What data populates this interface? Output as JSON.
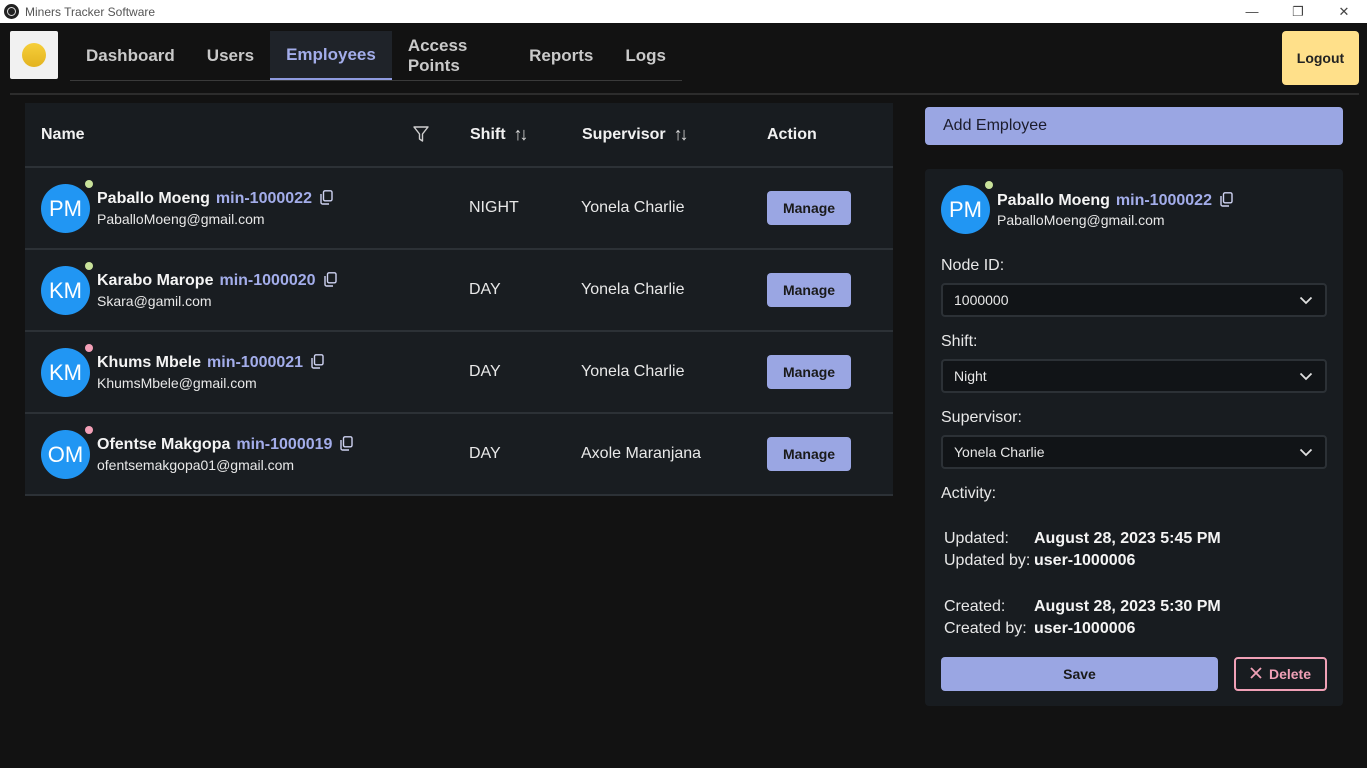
{
  "window": {
    "title": "Miners Tracker Software",
    "minimize": "—",
    "restore": "❐",
    "close": "✕"
  },
  "nav": {
    "items": [
      {
        "label": "Dashboard"
      },
      {
        "label": "Users"
      },
      {
        "label": "Employees",
        "active": true
      },
      {
        "label": "Access Points"
      },
      {
        "label": "Reports"
      },
      {
        "label": "Logs"
      }
    ],
    "logout_label": "Logout"
  },
  "table": {
    "headers": {
      "name": "Name",
      "shift": "Shift",
      "supervisor": "Supervisor",
      "action": "Action"
    },
    "rows": [
      {
        "initials": "PM",
        "name": "Paballo Moeng",
        "id": "min-1000022",
        "email": "PaballoMoeng@gmail.com",
        "shift": "NIGHT",
        "supervisor": "Yonela Charlie",
        "action": "Manage",
        "status_color": "#c9e29a"
      },
      {
        "initials": "KM",
        "name": "Karabo Marope",
        "id": "min-1000020",
        "email": "Skara@gamil.com",
        "shift": "DAY",
        "supervisor": "Yonela Charlie",
        "action": "Manage",
        "status_color": "#c9e29a"
      },
      {
        "initials": "KM",
        "name": "Khums Mbele",
        "id": "min-1000021",
        "email": "KhumsMbele@gmail.com",
        "shift": "DAY",
        "supervisor": "Yonela Charlie",
        "action": "Manage",
        "status_color": "#f3a0b7"
      },
      {
        "initials": "OM",
        "name": "Ofentse Makgopa",
        "id": "min-1000019",
        "email": "ofentsemakgopa01@gmail.com",
        "shift": "DAY",
        "supervisor": "Axole Maranjana",
        "action": "Manage",
        "status_color": "#f3a0b7"
      }
    ]
  },
  "panel": {
    "add_button": "Add Employee",
    "employee": {
      "initials": "PM",
      "name": "Paballo Moeng",
      "id": "min-1000022",
      "email": "PaballoMoeng@gmail.com",
      "status_color": "#c9e29a"
    },
    "node_id_label": "Node ID:",
    "node_id_value": "1000000",
    "shift_label": "Shift:",
    "shift_value": "Night",
    "supervisor_label": "Supervisor:",
    "supervisor_value": "Yonela Charlie",
    "activity_label": "Activity:",
    "updated_label": "Updated:",
    "updated_value": "August 28, 2023 5:45 PM",
    "updated_by_label": "Updated by:",
    "updated_by_value": "user-1000006",
    "created_label": "Created:",
    "created_value": "August 28, 2023 5:30 PM",
    "created_by_label": "Created by:",
    "created_by_value": "user-1000006",
    "save_label": "Save",
    "delete_label": "Delete"
  },
  "colors": {
    "accent": "#9aa6e3",
    "logout": "#ffe08a",
    "avatar": "#2196f3",
    "delete": "#f0a0b6"
  }
}
